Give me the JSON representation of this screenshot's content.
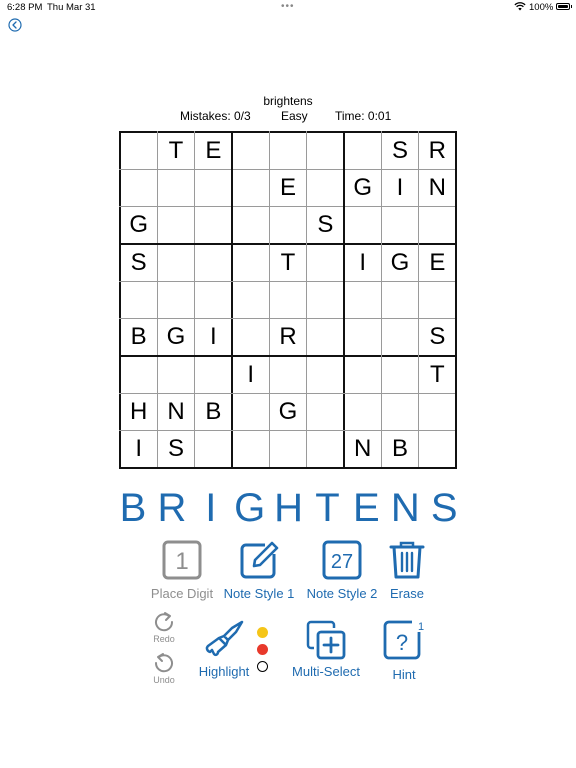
{
  "status_bar": {
    "time": "6:28 PM",
    "date": "Thu Mar 31",
    "battery": "100%"
  },
  "header": {
    "puzzle_name": "brightens",
    "mistakes": "Mistakes: 0/3",
    "difficulty": "Easy",
    "timer": "Time:  0:01"
  },
  "board": {
    "rows": [
      [
        "",
        "T",
        "E",
        "",
        "",
        "",
        "",
        "S",
        "R"
      ],
      [
        "",
        "",
        "",
        "",
        "E",
        "",
        "G",
        "I",
        "N"
      ],
      [
        "G",
        "",
        "",
        "",
        "",
        "S",
        "",
        "",
        ""
      ],
      [
        "S",
        "",
        "",
        "",
        "T",
        "",
        "I",
        "G",
        "E"
      ],
      [
        "",
        "",
        "",
        "",
        "",
        "",
        "",
        "",
        ""
      ],
      [
        "B",
        "G",
        "I",
        "",
        "R",
        "",
        "",
        "",
        "S"
      ],
      [
        "",
        "",
        "",
        "I",
        "",
        "",
        "",
        "",
        "T"
      ],
      [
        "H",
        "N",
        "B",
        "",
        "G",
        "",
        "",
        "",
        ""
      ],
      [
        "I",
        "S",
        "",
        "",
        "",
        "",
        "N",
        "B",
        ""
      ]
    ]
  },
  "word": [
    "B",
    "R",
    "I",
    "G",
    "H",
    "T",
    "E",
    "N",
    "S"
  ],
  "tools": {
    "place_digit": {
      "label": "Place Digit",
      "digit": "1"
    },
    "note_style_1": {
      "label": "Note Style 1"
    },
    "note_style_2": {
      "label": "Note Style 2",
      "digit": "27"
    },
    "erase": {
      "label": "Erase"
    },
    "redo": {
      "label": "Redo"
    },
    "undo": {
      "label": "Undo"
    },
    "highlight": {
      "label": "Highlight"
    },
    "multi_select": {
      "label": "Multi-Select"
    },
    "hint": {
      "label": "Hint",
      "glyph": "?",
      "count": "1"
    }
  },
  "highlight_colors": [
    "#f5c518",
    "#e8392b",
    "#ffffff"
  ],
  "accent_color": "#1f6bb0"
}
